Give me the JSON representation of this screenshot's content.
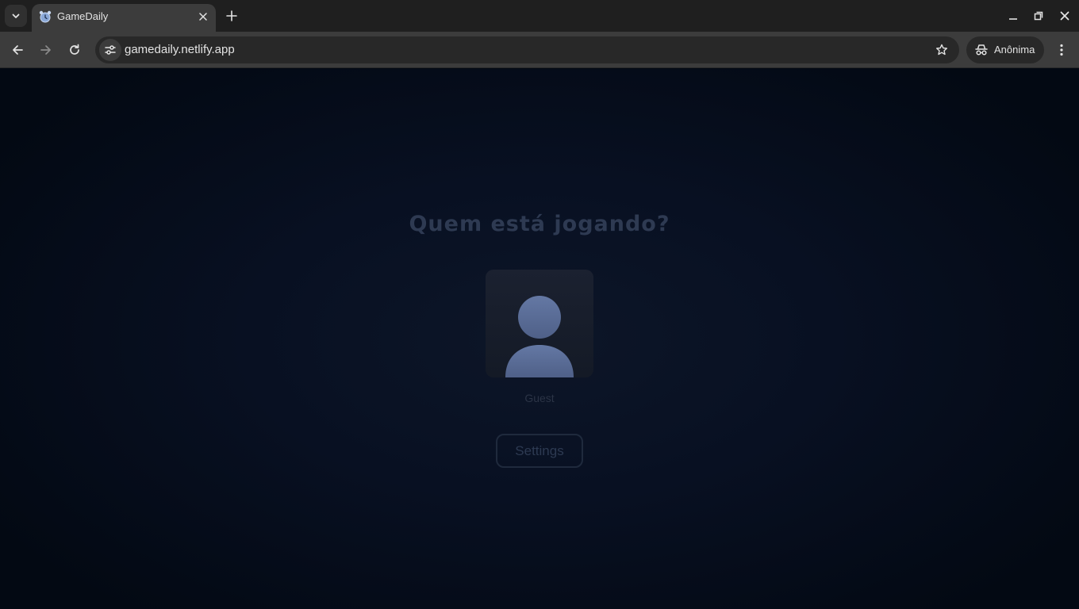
{
  "browser": {
    "tab": {
      "title": "GameDaily",
      "favicon": "alarm-clock-icon"
    },
    "address": {
      "url": "gamedaily.netlify.app"
    },
    "profile": {
      "label": "Anônima",
      "icon": "incognito-icon"
    }
  },
  "page": {
    "heading": "Quem está jogando?",
    "profiles": [
      {
        "name": "Guest",
        "avatar": "person-silhouette-icon"
      }
    ],
    "settings_label": "Settings"
  },
  "colors": {
    "chrome_tabstrip": "#1f1f1f",
    "chrome_toolbar": "#3c3c3c",
    "page_background": "#081022",
    "avatar_fill": "#5b6f98"
  }
}
